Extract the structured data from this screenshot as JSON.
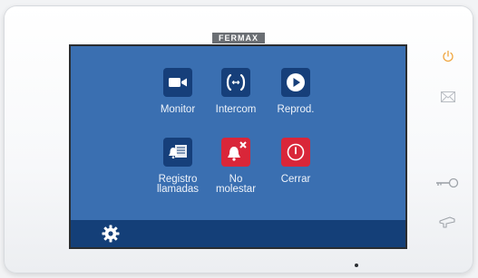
{
  "device": {
    "brand": "FERMAX"
  },
  "menu": {
    "items": [
      {
        "id": "monitor",
        "label": "Monitor",
        "icon": "video-camera-icon",
        "color": "#163f7a"
      },
      {
        "id": "intercom",
        "label": "Intercom",
        "icon": "intercom-icon",
        "color": "#163f7a"
      },
      {
        "id": "reprod",
        "label": "Reprod.",
        "icon": "play-icon",
        "color": "#163f7a"
      },
      {
        "id": "registro",
        "label": "Registro\nllamadas",
        "icon": "call-log-icon",
        "color": "#163f7a"
      },
      {
        "id": "no-molestar",
        "label": "No\nmolestar",
        "icon": "bell-muted-icon",
        "color": "#d92639"
      },
      {
        "id": "cerrar",
        "label": "Cerrar",
        "icon": "power-icon",
        "color": "#d92639"
      }
    ]
  },
  "bottom_bar": {
    "icon": "gear-icon"
  },
  "side_buttons": [
    {
      "id": "power",
      "icon": "power-icon",
      "color": "#f0a640"
    },
    {
      "id": "message",
      "icon": "envelope-icon",
      "color": "#b8bcc2"
    },
    {
      "id": "key",
      "icon": "key-icon",
      "color": "#9ea3a9"
    },
    {
      "id": "door",
      "icon": "door-opener-icon",
      "color": "#9ea3a9"
    }
  ]
}
